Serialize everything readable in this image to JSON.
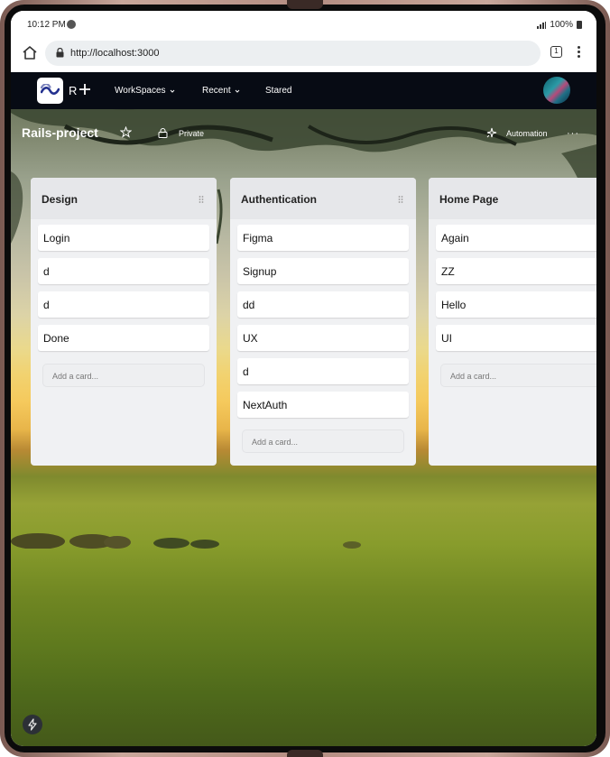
{
  "status_bar": {
    "time": "10:12 PM",
    "battery": "100%"
  },
  "browser": {
    "url": "http://localhost:3000",
    "tab_count": "1"
  },
  "navbar": {
    "logo_letter": "R",
    "items": [
      {
        "label": "WorkSpaces",
        "has_dropdown": true
      },
      {
        "label": "Recent",
        "has_dropdown": true
      },
      {
        "label": "Stared",
        "has_dropdown": false
      }
    ]
  },
  "board": {
    "title": "Rails-project",
    "visibility": "Private",
    "automation_label": "Automation",
    "more": "···"
  },
  "lists": [
    {
      "title": "Design",
      "cards": [
        "Login",
        "d",
        "d",
        "Done"
      ],
      "add_card_placeholder": "Add a card..."
    },
    {
      "title": "Authentication",
      "cards": [
        "Figma",
        "Signup",
        "dd",
        "UX",
        "d",
        "NextAuth"
      ],
      "add_card_placeholder": "Add a card..."
    },
    {
      "title": "Home Page",
      "cards": [
        "Again",
        "ZZ",
        "Hello",
        "UI"
      ],
      "add_card_placeholder": "Add a card..."
    }
  ],
  "colors": {
    "navbar_bg": "#070b14",
    "list_bg": "#f0f1f3",
    "list_header_bg": "#e6e7ea",
    "device_frame": "#b48d82"
  }
}
